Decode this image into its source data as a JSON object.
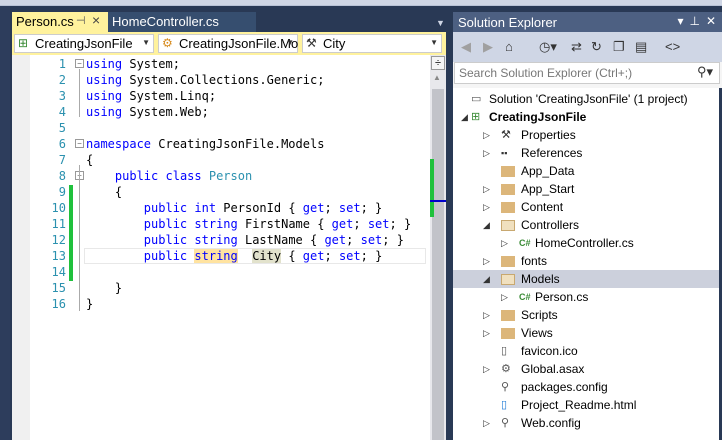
{
  "tabs": [
    {
      "label": "Person.cs",
      "active": true
    },
    {
      "label": "HomeController.cs",
      "active": false
    }
  ],
  "navbar": {
    "project": "CreatingJsonFile",
    "type": "CreatingJsonFile.Mo",
    "member": "City"
  },
  "code": {
    "lines": [
      {
        "n": "1",
        "t": [
          [
            "kw",
            "using"
          ],
          [
            "pl",
            " System;"
          ]
        ]
      },
      {
        "n": "2",
        "t": [
          [
            "kw",
            "using"
          ],
          [
            "pl",
            " System.Collections.Generic;"
          ]
        ]
      },
      {
        "n": "3",
        "t": [
          [
            "kw",
            "using"
          ],
          [
            "pl",
            " System.Linq;"
          ]
        ]
      },
      {
        "n": "4",
        "t": [
          [
            "kw",
            "using"
          ],
          [
            "pl",
            " System.Web;"
          ]
        ]
      },
      {
        "n": "5",
        "t": []
      },
      {
        "n": "6",
        "t": [
          [
            "kw",
            "namespace"
          ],
          [
            "pl",
            " CreatingJsonFile.Models"
          ]
        ]
      },
      {
        "n": "7",
        "t": [
          [
            "pl",
            "{"
          ]
        ]
      },
      {
        "n": "8",
        "t": [
          [
            "pl",
            "    "
          ],
          [
            "kw",
            "public"
          ],
          [
            "pl",
            " "
          ],
          [
            "kw",
            "class"
          ],
          [
            "pl",
            " "
          ],
          [
            "ty",
            "Person"
          ]
        ]
      },
      {
        "n": "9",
        "t": [
          [
            "pl",
            "    {"
          ]
        ]
      },
      {
        "n": "10",
        "t": [
          [
            "pl",
            "        "
          ],
          [
            "kw",
            "public"
          ],
          [
            "pl",
            " "
          ],
          [
            "kw",
            "int"
          ],
          [
            "pl",
            " PersonId { "
          ],
          [
            "kw",
            "get"
          ],
          [
            "pl",
            "; "
          ],
          [
            "kw",
            "set"
          ],
          [
            "pl",
            "; }"
          ]
        ]
      },
      {
        "n": "11",
        "t": [
          [
            "pl",
            "        "
          ],
          [
            "kw",
            "public"
          ],
          [
            "pl",
            " "
          ],
          [
            "kw",
            "string"
          ],
          [
            "pl",
            " FirstName { "
          ],
          [
            "kw",
            "get"
          ],
          [
            "pl",
            "; "
          ],
          [
            "kw",
            "set"
          ],
          [
            "pl",
            "; }"
          ]
        ]
      },
      {
        "n": "12",
        "t": [
          [
            "pl",
            "        "
          ],
          [
            "kw",
            "public"
          ],
          [
            "pl",
            " "
          ],
          [
            "kw",
            "string"
          ],
          [
            "pl",
            " LastName { "
          ],
          [
            "kw",
            "get"
          ],
          [
            "pl",
            "; "
          ],
          [
            "kw",
            "set"
          ],
          [
            "pl",
            "; }"
          ]
        ]
      },
      {
        "n": "13",
        "t": [
          [
            "pl",
            "        "
          ],
          [
            "kw",
            "public"
          ],
          [
            "pl",
            " "
          ],
          [
            "kw hl1",
            "string"
          ],
          [
            "pl",
            "  "
          ],
          [
            "pl hl2",
            "City"
          ],
          [
            "pl",
            " { "
          ],
          [
            "kw",
            "get"
          ],
          [
            "pl",
            "; "
          ],
          [
            "kw",
            "set"
          ],
          [
            "pl",
            "; }"
          ]
        ]
      },
      {
        "n": "14",
        "t": []
      },
      {
        "n": "15",
        "t": [
          [
            "pl",
            "    }"
          ]
        ]
      },
      {
        "n": "16",
        "t": [
          [
            "pl",
            "}"
          ]
        ]
      }
    ]
  },
  "solution_explorer": {
    "title": "Solution Explorer",
    "search_placeholder": "Search Solution Explorer (Ctrl+;)",
    "items": [
      {
        "label": "Solution 'CreatingJsonFile' (1 project)",
        "icon": "solution-icon",
        "level": 0,
        "expander": ""
      },
      {
        "label": "CreatingJsonFile",
        "icon": "web-project-icon",
        "level": 0,
        "expander": "expanded",
        "bold": true
      },
      {
        "label": "Properties",
        "icon": "wrench-icon",
        "level": 1,
        "expander": "collapsed"
      },
      {
        "label": "References",
        "icon": "references-icon",
        "level": 1,
        "expander": "collapsed"
      },
      {
        "label": "App_Data",
        "icon": "folder-icon",
        "level": 1,
        "expander": ""
      },
      {
        "label": "App_Start",
        "icon": "folder-icon",
        "level": 1,
        "expander": "collapsed"
      },
      {
        "label": "Content",
        "icon": "folder-icon",
        "level": 1,
        "expander": "collapsed"
      },
      {
        "label": "Controllers",
        "icon": "folder-open-icon",
        "level": 1,
        "expander": "expanded"
      },
      {
        "label": "HomeController.cs",
        "icon": "csharp-file-icon",
        "level": 2,
        "expander": "collapsed"
      },
      {
        "label": "fonts",
        "icon": "folder-icon",
        "level": 1,
        "expander": "collapsed"
      },
      {
        "label": "Models",
        "icon": "folder-open-icon",
        "level": 1,
        "expander": "expanded",
        "selected": true
      },
      {
        "label": "Person.cs",
        "icon": "csharp-file-icon",
        "level": 2,
        "expander": "collapsed"
      },
      {
        "label": "Scripts",
        "icon": "folder-icon",
        "level": 1,
        "expander": "collapsed"
      },
      {
        "label": "Views",
        "icon": "folder-icon",
        "level": 1,
        "expander": "collapsed"
      },
      {
        "label": "favicon.ico",
        "icon": "image-file-icon",
        "level": 1,
        "expander": ""
      },
      {
        "label": "Global.asax",
        "icon": "asax-file-icon",
        "level": 1,
        "expander": "collapsed"
      },
      {
        "label": "packages.config",
        "icon": "config-file-icon",
        "level": 1,
        "expander": ""
      },
      {
        "label": "Project_Readme.html",
        "icon": "html-file-icon",
        "level": 1,
        "expander": ""
      },
      {
        "label": "Web.config",
        "icon": "config-file-icon",
        "level": 1,
        "expander": "collapsed"
      }
    ]
  }
}
